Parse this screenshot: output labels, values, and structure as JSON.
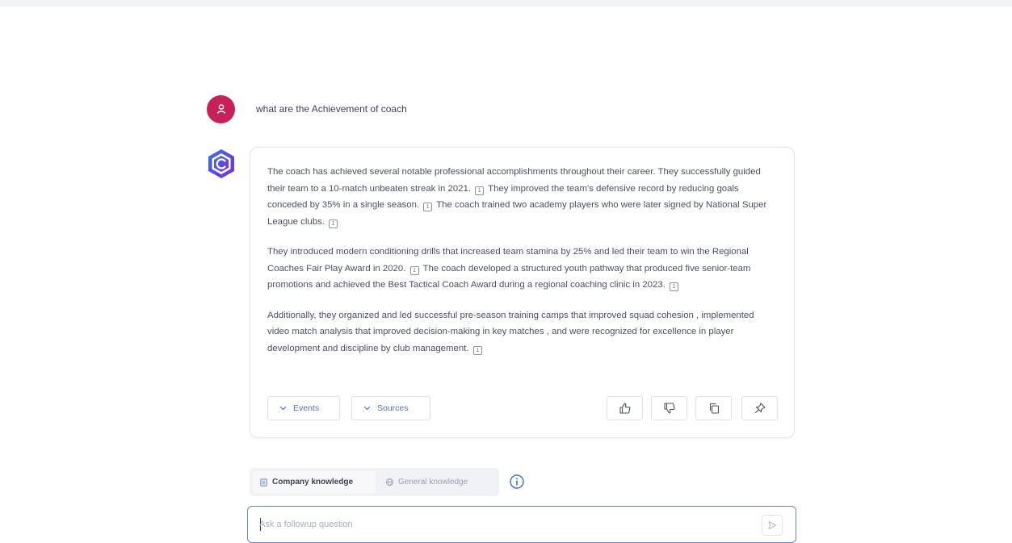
{
  "user_message": {
    "text": "what are the Achievement of coach"
  },
  "answer": {
    "paragraphs": [
      {
        "segments": [
          "The coach has achieved several notable professional accomplishments throughout their career. They successfully guided their team to a 10-match unbeaten streak in 2021.",
          "They improved the team's defensive record by reducing goals conceded by 35% in a single season.",
          "The coach trained two academy players who were later signed by National Super League clubs."
        ]
      },
      {
        "segments": [
          "They introduced modern conditioning drills that increased team stamina by 25% and led their team to win the Regional Coaches Fair Play Award in 2020.",
          "The coach developed a structured youth pathway that produced five senior-team promotions and achieved the Best Tactical Coach Award during a regional coaching clinic in 2023."
        ]
      },
      {
        "segments": [
          "Additionally, they organized and led successful pre-season training camps that improved squad cohesion , implemented video match analysis that improved decision-making in key matches , and were recognized for excellence in player development and discipline by club management."
        ]
      }
    ],
    "citation_label": "1",
    "actions": {
      "events_label": "Events",
      "sources_label": "Sources",
      "icons": [
        "thumbs-up-icon",
        "thumbs-down-icon",
        "copy-icon",
        "pin-icon"
      ]
    }
  },
  "knowledge_toggle": {
    "company_label": "Company knowledge",
    "general_label": "General knowledge",
    "selected": "Company knowledge"
  },
  "followup_input": {
    "placeholder": "Ask a followup question",
    "value": ""
  },
  "colors": {
    "user_avatar": "#c8215a",
    "bot_avatar": "#5b3fd6",
    "accent": "#5a6fb0",
    "input_border": "#6b86c8"
  }
}
